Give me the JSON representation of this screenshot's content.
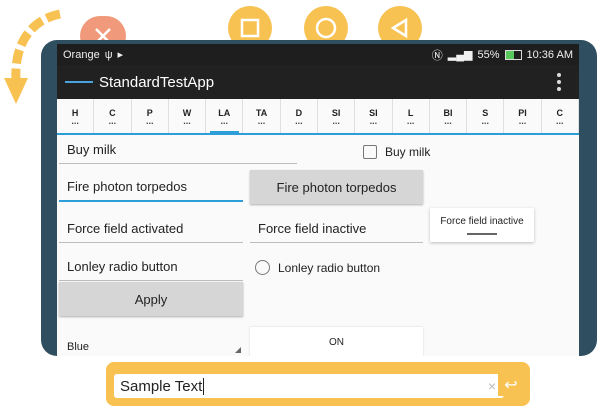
{
  "status_bar": {
    "carrier": "Orange",
    "signal_text": "55%",
    "time": "10:36 AM"
  },
  "app_bar": {
    "title": "StandardTestApp"
  },
  "tabs": [
    {
      "label": "H"
    },
    {
      "label": "C"
    },
    {
      "label": "P"
    },
    {
      "label": "W"
    },
    {
      "label": "LA"
    },
    {
      "label": "TA"
    },
    {
      "label": "D"
    },
    {
      "label": "SI"
    },
    {
      "label": "SI"
    },
    {
      "label": "L"
    },
    {
      "label": "BI"
    },
    {
      "label": "S"
    },
    {
      "label": "PI"
    },
    {
      "label": "C"
    }
  ],
  "tab_dots": "...",
  "form": {
    "buy_milk_field": "Buy milk",
    "buy_milk_checkbox": "Buy milk",
    "fire_field": "Fire photon torpedos",
    "fire_button": "Fire photon torpedos",
    "force_active_field": "Force field activated",
    "force_inactive_field": "Force field inactive",
    "force_inactive_toggle": "Force field inactive",
    "radio_field": "Lonley radio button",
    "radio_label": "Lonley radio button",
    "apply_button": "Apply",
    "spinner_value": "Blue",
    "switch_label": "ON"
  },
  "text_input": {
    "value": "Sample Text",
    "clear_symbol": "×"
  }
}
